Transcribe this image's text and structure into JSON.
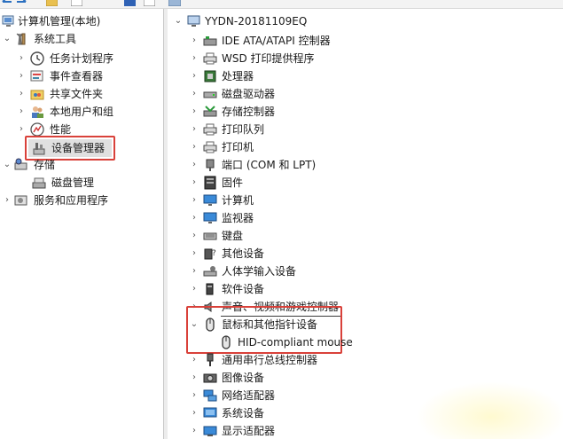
{
  "left_tree": {
    "root": {
      "label": "计算机管理(本地)",
      "icon": "computer-management-icon"
    },
    "system_tools": {
      "label": "系统工具",
      "icon": "tools-icon"
    },
    "items": [
      {
        "label": "任务计划程序",
        "icon": "clock-icon"
      },
      {
        "label": "事件查看器",
        "icon": "event-viewer-icon"
      },
      {
        "label": "共享文件夹",
        "icon": "shared-folder-icon"
      },
      {
        "label": "本地用户和组",
        "icon": "users-icon"
      },
      {
        "label": "性能",
        "icon": "performance-icon"
      },
      {
        "label": "设备管理器",
        "icon": "device-manager-icon"
      }
    ],
    "storage": {
      "label": "存储",
      "icon": "storage-icon"
    },
    "disk_management": {
      "label": "磁盘管理",
      "icon": "disk-management-icon"
    },
    "services": {
      "label": "服务和应用程序",
      "icon": "services-icon"
    }
  },
  "device_tree": {
    "root": {
      "label": "YYDN-20181109EQ",
      "icon": "computer-icon"
    },
    "categories": [
      {
        "label": "IDE ATA/ATAPI 控制器",
        "icon": "ide-controller-icon"
      },
      {
        "label": "WSD 打印提供程序",
        "icon": "printer-icon"
      },
      {
        "label": "处理器",
        "icon": "processor-icon"
      },
      {
        "label": "磁盘驱动器",
        "icon": "disk-drive-icon"
      },
      {
        "label": "存储控制器",
        "icon": "storage-controller-icon"
      },
      {
        "label": "打印队列",
        "icon": "printer-icon"
      },
      {
        "label": "打印机",
        "icon": "printer-icon"
      },
      {
        "label": "端口 (COM 和 LPT)",
        "icon": "port-icon"
      },
      {
        "label": "固件",
        "icon": "firmware-icon"
      },
      {
        "label": "计算机",
        "icon": "monitor-icon"
      },
      {
        "label": "监视器",
        "icon": "monitor-icon"
      },
      {
        "label": "键盘",
        "icon": "keyboard-icon"
      },
      {
        "label": "其他设备",
        "icon": "unknown-device-icon"
      },
      {
        "label": "人体学输入设备",
        "icon": "hid-icon"
      },
      {
        "label": "软件设备",
        "icon": "software-device-icon"
      },
      {
        "label": "声音、视频和游戏控制器",
        "icon": "speaker-icon"
      },
      {
        "label": "鼠标和其他指针设备",
        "icon": "mouse-icon"
      },
      {
        "label": "HID-compliant mouse",
        "icon": "mouse-icon"
      },
      {
        "label": "通用串行总线控制器",
        "icon": "usb-icon"
      },
      {
        "label": "图像设备",
        "icon": "camera-icon"
      },
      {
        "label": "网络适配器",
        "icon": "network-adapter-icon"
      },
      {
        "label": "系统设备",
        "icon": "system-device-icon"
      },
      {
        "label": "显示适配器",
        "icon": "display-adapter-icon"
      }
    ]
  },
  "colors": {
    "highlight_box": "#d9413a",
    "selection_bg": "#e0e0e0"
  }
}
